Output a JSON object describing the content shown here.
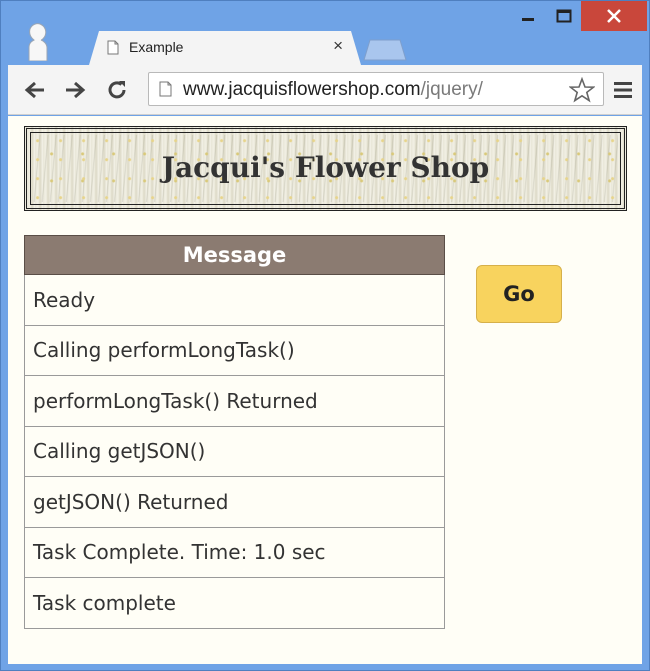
{
  "browser": {
    "tab_title": "Example",
    "tab_close": "×",
    "url_host": "www.jacquisflowershop.com",
    "url_path": "/jquery/"
  },
  "page": {
    "title": "Jacqui's Flower Shop",
    "table_header": "Message",
    "messages": [
      "Ready",
      "Calling performLongTask()",
      "performLongTask() Returned",
      "Calling getJSON()",
      "getJSON() Returned",
      "Task Complete. Time: 1.0 sec",
      "Task complete"
    ],
    "go_label": "Go"
  },
  "icons": {
    "back": "arrow-left-icon",
    "forward": "arrow-right-icon",
    "reload": "reload-icon",
    "bookmark": "star-icon",
    "menu": "hamburger-menu-icon"
  },
  "colors": {
    "title_bar": "#6fa3e6",
    "close_button": "#c9473b",
    "table_header_bg": "#8b7b71",
    "go_button_bg": "#f8d35e",
    "page_bg": "#fffef6"
  }
}
